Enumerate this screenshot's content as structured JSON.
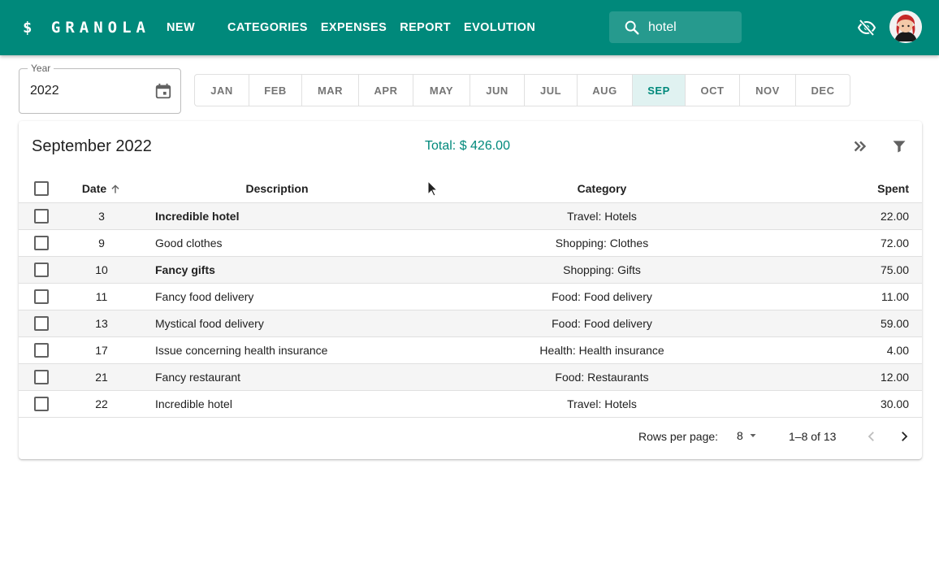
{
  "app": {
    "brand": "$ GRANOLA",
    "nav": [
      "NEW",
      "CATEGORIES",
      "EXPENSES",
      "REPORT",
      "EVOLUTION"
    ],
    "search": {
      "value": "hotel",
      "placeholder": ""
    },
    "icons": {
      "search": "search-icon",
      "visibility": "visibility-off-icon",
      "avatar": "user-avatar"
    },
    "colors": {
      "primary": "#00897b",
      "active_month_bg": "#e0f2f1",
      "row_stripe": "#f5f5f5"
    }
  },
  "filters": {
    "year_label": "Year",
    "year_value": "2022",
    "months": [
      "JAN",
      "FEB",
      "MAR",
      "APR",
      "MAY",
      "JUN",
      "JUL",
      "AUG",
      "SEP",
      "OCT",
      "NOV",
      "DEC"
    ],
    "selected_month": "SEP"
  },
  "card": {
    "title": "September 2022",
    "total": "Total: $ 426.00"
  },
  "table": {
    "headers": {
      "date": "Date",
      "description": "Description",
      "category": "Category",
      "spent": "Spent"
    },
    "sort": {
      "column": "Date",
      "direction": "ascending"
    },
    "rows": [
      {
        "date": "3",
        "description": "Incredible hotel",
        "category": "Travel: Hotels",
        "spent": "22.00",
        "bold": true
      },
      {
        "date": "9",
        "description": "Good clothes",
        "category": "Shopping: Clothes",
        "spent": "72.00",
        "bold": false
      },
      {
        "date": "10",
        "description": "Fancy gifts",
        "category": "Shopping: Gifts",
        "spent": "75.00",
        "bold": true
      },
      {
        "date": "11",
        "description": "Fancy food delivery",
        "category": "Food: Food delivery",
        "spent": "11.00",
        "bold": false
      },
      {
        "date": "13",
        "description": "Mystical food delivery",
        "category": "Food: Food delivery",
        "spent": "59.00",
        "bold": false
      },
      {
        "date": "17",
        "description": "Issue concerning health insurance",
        "category": "Health: Health insurance",
        "spent": "4.00",
        "bold": false
      },
      {
        "date": "21",
        "description": "Fancy restaurant",
        "category": "Food: Restaurants",
        "spent": "12.00",
        "bold": false
      },
      {
        "date": "22",
        "description": "Incredible hotel",
        "category": "Travel: Hotels",
        "spent": "30.00",
        "bold": false
      }
    ]
  },
  "pagination": {
    "rows_per_page_label": "Rows per page:",
    "rows_per_page": "8",
    "range": "1–8 of 13"
  }
}
